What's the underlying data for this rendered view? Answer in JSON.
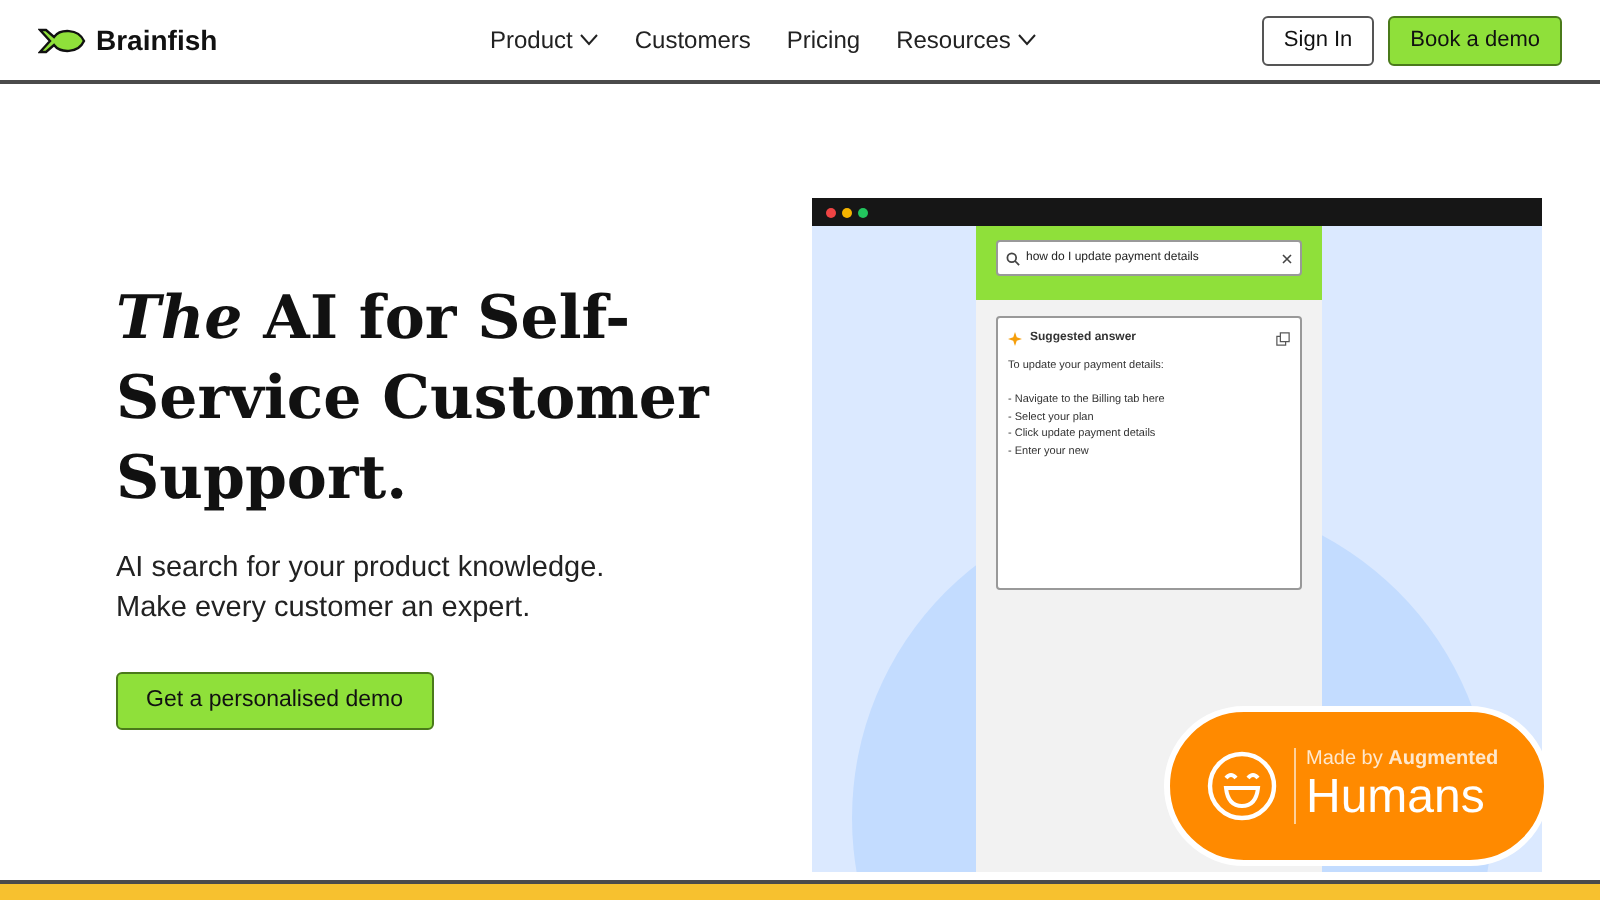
{
  "header": {
    "brand": "Brainfish",
    "nav": [
      {
        "label": "Product",
        "dropdown": true
      },
      {
        "label": "Customers",
        "dropdown": false
      },
      {
        "label": "Pricing",
        "dropdown": false
      },
      {
        "label": "Resources",
        "dropdown": true
      }
    ],
    "sign_in": "Sign In",
    "cta": "Book a demo"
  },
  "hero": {
    "title_italic": "The",
    "title_rest": "AI for Self-Service Customer Support.",
    "subtitle": [
      "AI search for your product knowledge.",
      "Make every customer an expert."
    ],
    "cta": "Get a personalised demo"
  },
  "mockup": {
    "search_value": "how do I update payment details",
    "answer_title": "Suggested answer",
    "answer_lines": [
      "To update your payment details:",
      "- Navigate to the Billing tab here",
      "- Select your plan",
      "- Click update payment details",
      "- Enter your new"
    ]
  },
  "badge": {
    "caption": "Made by **Augmented**",
    "name": "Humans"
  }
}
